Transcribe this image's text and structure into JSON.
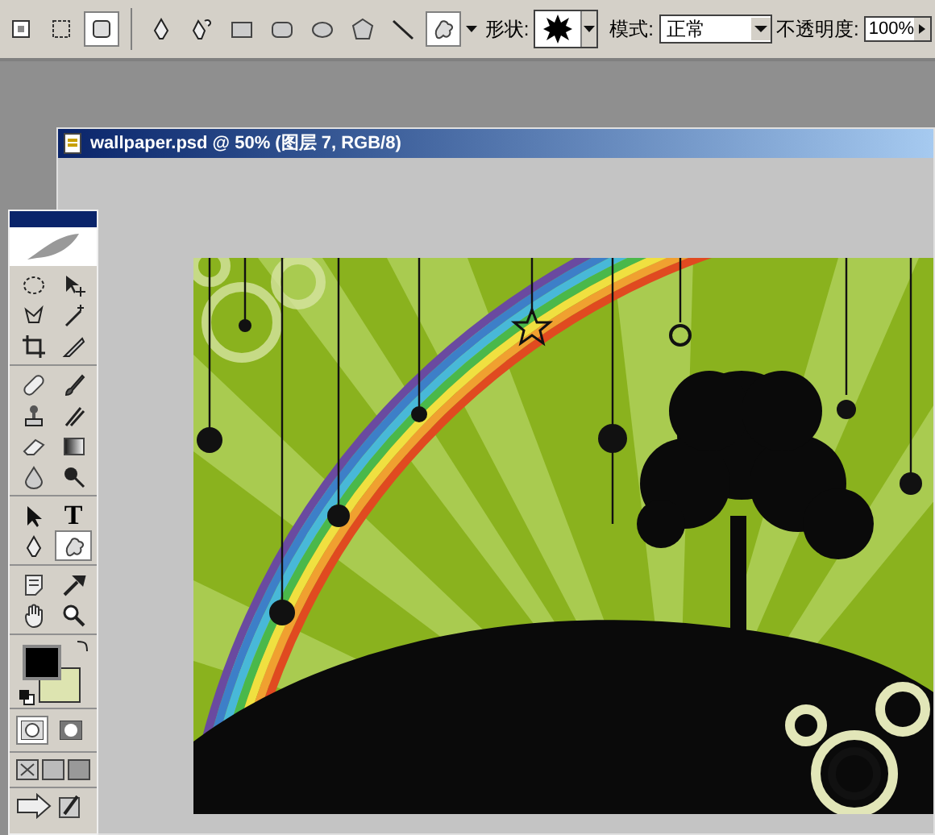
{
  "options_bar": {
    "mode_buttons": [
      {
        "kind": "shape-layers",
        "selected": false
      },
      {
        "kind": "paths",
        "selected": false
      },
      {
        "kind": "fill-pixels",
        "selected": true
      }
    ],
    "tools": [
      {
        "kind": "pen",
        "selected": false
      },
      {
        "kind": "freeform-pen",
        "selected": false
      },
      {
        "kind": "rectangle",
        "selected": false
      },
      {
        "kind": "rounded-rectangle",
        "selected": false
      },
      {
        "kind": "ellipse",
        "selected": false
      },
      {
        "kind": "polygon",
        "selected": false
      },
      {
        "kind": "line",
        "selected": false
      },
      {
        "kind": "custom-shape",
        "selected": true
      }
    ],
    "shape_label": "形状:",
    "mode_label": "模式:",
    "mode_value": "正常",
    "opacity_label": "不透明度:",
    "opacity_value": "100%"
  },
  "document": {
    "title": "wallpaper.psd @ 50% (图层 7, RGB/8)"
  },
  "toolbox": {
    "groups": [
      [
        {
          "kind": "marquee",
          "selected": false
        },
        {
          "kind": "move",
          "selected": false
        },
        {
          "kind": "lasso",
          "selected": false
        },
        {
          "kind": "magic-wand",
          "selected": false
        },
        {
          "kind": "crop",
          "selected": false
        },
        {
          "kind": "slice",
          "selected": false
        }
      ],
      [
        {
          "kind": "healing",
          "selected": false
        },
        {
          "kind": "brush",
          "selected": false
        },
        {
          "kind": "stamp",
          "selected": false
        },
        {
          "kind": "history-brush",
          "selected": false
        },
        {
          "kind": "eraser",
          "selected": false
        },
        {
          "kind": "gradient",
          "selected": false
        },
        {
          "kind": "blur",
          "selected": false
        },
        {
          "kind": "dodge",
          "selected": false
        }
      ],
      [
        {
          "kind": "path-select",
          "selected": false
        },
        {
          "kind": "type",
          "selected": false,
          "label": "T"
        },
        {
          "kind": "pen",
          "selected": false
        },
        {
          "kind": "custom-shape",
          "selected": true
        }
      ],
      [
        {
          "kind": "notes",
          "selected": false
        },
        {
          "kind": "eyedropper",
          "selected": false
        },
        {
          "kind": "hand",
          "selected": false
        },
        {
          "kind": "zoom",
          "selected": false
        }
      ]
    ],
    "foreground": {
      "color": "#000000"
    },
    "background": {
      "color": "#dde4b0"
    },
    "quick_mask": {
      "selected": false
    }
  }
}
